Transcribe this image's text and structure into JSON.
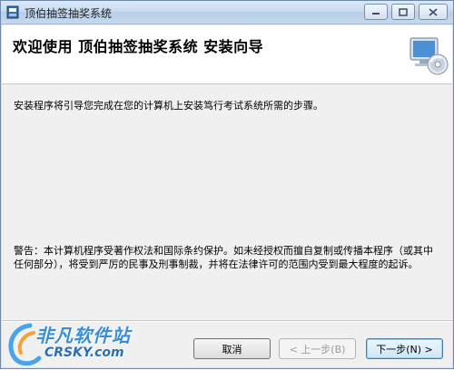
{
  "window": {
    "title": "顶伯抽签抽奖系统",
    "controls": {
      "minimize": "▭",
      "maximize": "▢",
      "close": "✕"
    }
  },
  "header": {
    "title": "欢迎使用  顶伯抽签抽奖系统  安装向导",
    "icon": "computer-cd-icon"
  },
  "content": {
    "intro": "安装程序将引导您完成在您的计算机上安装笃行考试系统所需的步骤。",
    "warning": "警告：本计算机程序受著作权法和国际条约保护。如未经授权而擅自复制或传播本程序（或其中任何部分），将受到严厉的民事及刑事制裁，并将在法律许可的范围内受到最大程度的起诉。"
  },
  "buttons": {
    "cancel": "取消",
    "back": "< 上一步(B)",
    "next": "下一步(N) >"
  },
  "watermark": {
    "cn": "非凡软件站",
    "en": "CRSKY.com"
  },
  "colors": {
    "titlebar": "#c9dcf0",
    "header_bg": "#ffffff",
    "body_bg": "#f0f0f0",
    "watermark": "#3a8ed8"
  }
}
